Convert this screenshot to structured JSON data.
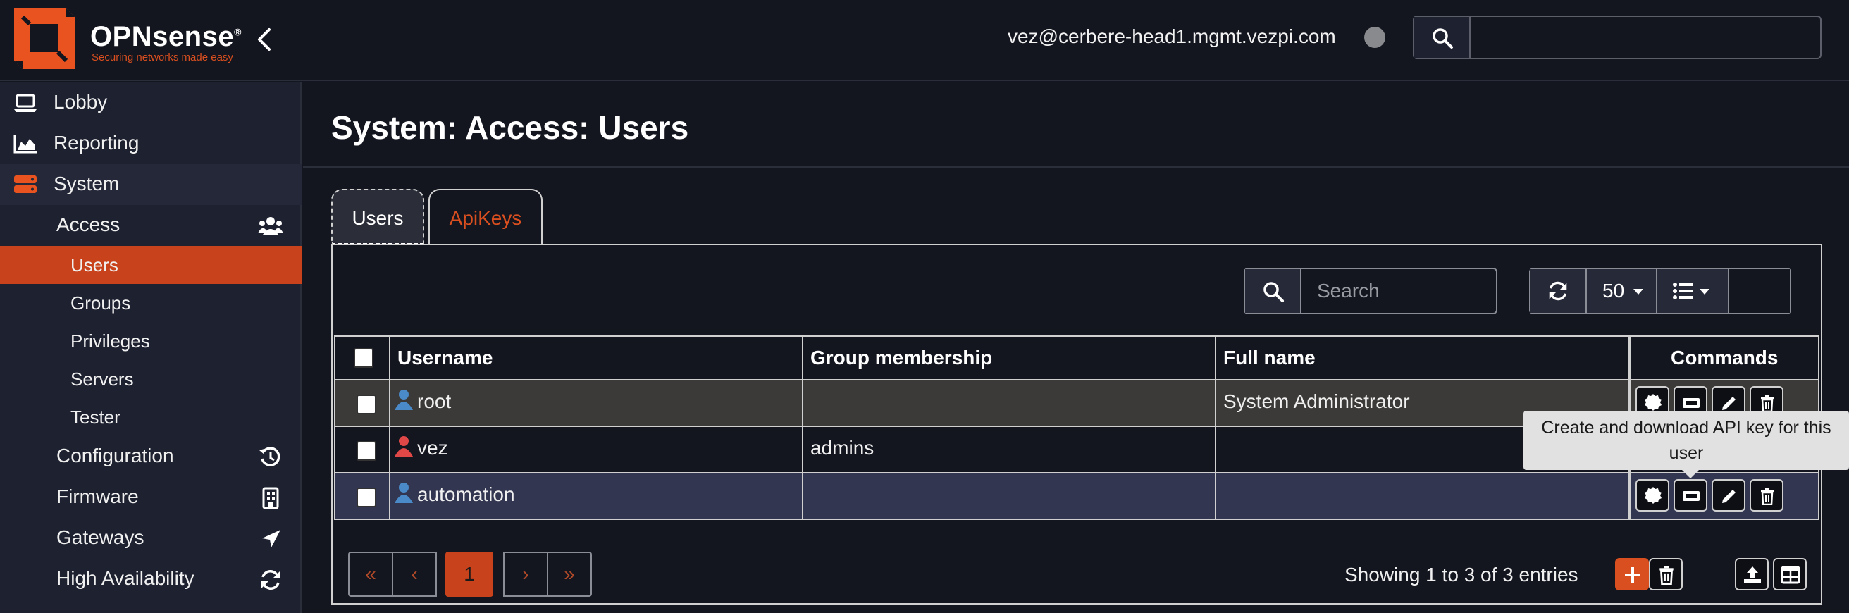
{
  "brand": {
    "name": "OPNsense",
    "registered": "®",
    "tagline": "Securing networks made easy",
    "logo_color": "#e8531f"
  },
  "header": {
    "user_email": "vez@cerbere-head1.mgmt.vezpi.com",
    "search_placeholder": ""
  },
  "sidebar": {
    "items": [
      {
        "label": "Lobby",
        "icon": "laptop-icon"
      },
      {
        "label": "Reporting",
        "icon": "area-chart-icon"
      },
      {
        "label": "System",
        "icon": "server-icon"
      },
      {
        "label": "Access",
        "icon": "users-icon"
      },
      {
        "label": "Users"
      },
      {
        "label": "Groups"
      },
      {
        "label": "Privileges"
      },
      {
        "label": "Servers"
      },
      {
        "label": "Tester"
      },
      {
        "label": "Configuration",
        "icon": "history-icon"
      },
      {
        "label": "Firmware",
        "icon": "building-icon"
      },
      {
        "label": "Gateways",
        "icon": "location-arrow-icon"
      },
      {
        "label": "High Availability",
        "icon": "refresh-icon"
      }
    ]
  },
  "page": {
    "title": "System: Access: Users",
    "tabs": [
      {
        "label": "Users",
        "active": true
      },
      {
        "label": "ApiKeys",
        "active": false
      }
    ]
  },
  "grid": {
    "search_placeholder": "Search",
    "rows_per_page": "50",
    "columns": [
      "Username",
      "Group membership",
      "Full name",
      "Commands"
    ],
    "rows": [
      {
        "username": "root",
        "group": "",
        "fullname": "System Administrator",
        "icon_color": "#4a8ac9"
      },
      {
        "username": "vez",
        "group": "admins",
        "fullname": "",
        "icon_color": "#e04848"
      },
      {
        "username": "automation",
        "group": "",
        "fullname": "",
        "icon_color": "#4a8ac9"
      }
    ],
    "tooltip": "Create and download API key for this user",
    "pagination": {
      "first": "«",
      "prev": "‹",
      "current": "1",
      "next": "›",
      "last": "»"
    },
    "showing": "Showing 1 to 3 of 3 entries"
  },
  "colors": {
    "accent": "#c8421c",
    "background": "#13151f",
    "sidebar": "#1e2130"
  }
}
